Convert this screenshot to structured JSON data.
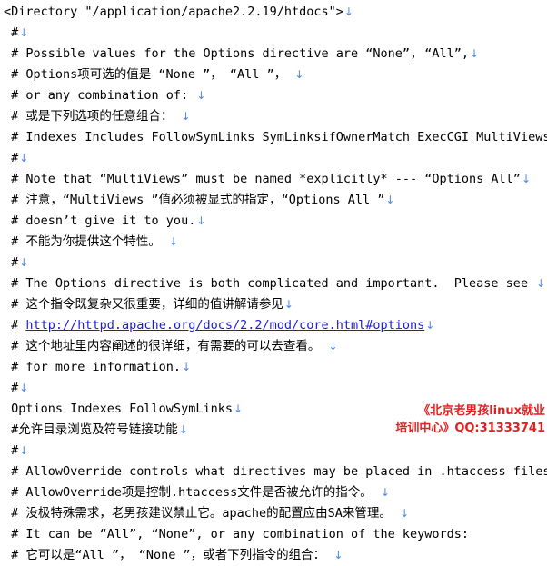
{
  "document": {
    "eol_marker": "↓",
    "lines": [
      {
        "segments": [
          {
            "type": "code",
            "text": "<Directory \"/application/apache2.2.19/htdocs\">"
          }
        ],
        "eol": true
      },
      {
        "segments": [
          {
            "type": "code",
            "text": " #"
          }
        ],
        "eol": true
      },
      {
        "segments": [
          {
            "type": "code",
            "text": " # Possible values for the Options directive are “None”, “All”,"
          }
        ],
        "eol": true
      },
      {
        "segments": [
          {
            "type": "code",
            "text": " # Options"
          },
          {
            "type": "cjk",
            "text": "项可选的值是"
          },
          {
            "type": "code",
            "text": " “None ”， “All ”， "
          }
        ],
        "eol": true
      },
      {
        "segments": [
          {
            "type": "code",
            "text": " # or any combination of: "
          }
        ],
        "eol": true
      },
      {
        "segments": [
          {
            "type": "code",
            "text": " # "
          },
          {
            "type": "cjk",
            "text": "或是下列选项的任意组合："
          },
          {
            "type": "code",
            "text": " "
          }
        ],
        "eol": true
      },
      {
        "segments": [
          {
            "type": "code",
            "text": " # Indexes Includes FollowSymLinks SymLinksifOwnerMatch ExecCGI MultiViews"
          }
        ],
        "eol": true
      },
      {
        "segments": [
          {
            "type": "code",
            "text": " #"
          }
        ],
        "eol": true
      },
      {
        "segments": [
          {
            "type": "code",
            "text": " # Note that “MultiViews” must be named *explicitly* --- “Options All”"
          }
        ],
        "eol": true
      },
      {
        "segments": [
          {
            "type": "code",
            "text": " # "
          },
          {
            "type": "cjk",
            "text": "注意，"
          },
          {
            "type": "code",
            "text": "“MultiViews ”"
          },
          {
            "type": "cjk",
            "text": "值必须被显式的指定，"
          },
          {
            "type": "code",
            "text": "“Options All ”"
          }
        ],
        "eol": true
      },
      {
        "segments": [
          {
            "type": "code",
            "text": " # doesn’t give it to you."
          }
        ],
        "eol": true
      },
      {
        "segments": [
          {
            "type": "code",
            "text": " # "
          },
          {
            "type": "cjk",
            "text": "不能为你提供这个特性。"
          },
          {
            "type": "code",
            "text": " "
          }
        ],
        "eol": true
      },
      {
        "segments": [
          {
            "type": "code",
            "text": " #"
          }
        ],
        "eol": true
      },
      {
        "segments": [
          {
            "type": "code",
            "text": " # The Options directive is both complicated and important.  Please see "
          }
        ],
        "eol": true
      },
      {
        "segments": [
          {
            "type": "code",
            "text": " # "
          },
          {
            "type": "cjk",
            "text": "这个指令既复杂又很重要，详细的值讲解请参见"
          }
        ],
        "eol": true
      },
      {
        "segments": [
          {
            "type": "code",
            "text": " # "
          },
          {
            "type": "link",
            "text": "http://httpd.apache.org/docs/2.2/mod/core.html#options"
          }
        ],
        "eol": true
      },
      {
        "segments": [
          {
            "type": "code",
            "text": " # "
          },
          {
            "type": "cjk",
            "text": "这个地址里内容阐述的很详细，有需要的可以去查看。"
          },
          {
            "type": "code",
            "text": " "
          }
        ],
        "eol": true
      },
      {
        "segments": [
          {
            "type": "code",
            "text": " # for more information."
          }
        ],
        "eol": true
      },
      {
        "segments": [
          {
            "type": "code",
            "text": " #"
          }
        ],
        "eol": true
      },
      {
        "segments": [
          {
            "type": "code",
            "text": " Options Indexes FollowSymLinks"
          }
        ],
        "eol": true
      },
      {
        "segments": [
          {
            "type": "code",
            "text": " #"
          },
          {
            "type": "cjk",
            "text": "允许目录浏览及符号链接功能"
          }
        ],
        "eol": true
      },
      {
        "segments": [
          {
            "type": "code",
            "text": " #"
          }
        ],
        "eol": true
      },
      {
        "segments": [
          {
            "type": "code",
            "text": " # AllowOverride controls what directives may be placed in .htaccess files."
          }
        ],
        "eol": false
      },
      {
        "segments": [
          {
            "type": "code",
            "text": " # AllowOverride"
          },
          {
            "type": "cjk",
            "text": "项是控制"
          },
          {
            "type": "code",
            "text": ".htaccess"
          },
          {
            "type": "cjk",
            "text": "文件是否被允许的指令。"
          },
          {
            "type": "code",
            "text": " "
          }
        ],
        "eol": true
      },
      {
        "segments": [
          {
            "type": "code",
            "text": " # "
          },
          {
            "type": "cjk",
            "text": "没极特殊需求，老男孩建议禁止它。"
          },
          {
            "type": "code",
            "text": "apache"
          },
          {
            "type": "cjk",
            "text": "的配置应由"
          },
          {
            "type": "code",
            "text": "SA"
          },
          {
            "type": "cjk",
            "text": "来管理。"
          },
          {
            "type": "code",
            "text": " "
          }
        ],
        "eol": true
      },
      {
        "segments": [
          {
            "type": "code",
            "text": " # It can be “All”, “None”, or any combination of the keywords:"
          }
        ],
        "eol": false
      },
      {
        "segments": [
          {
            "type": "code",
            "text": " # "
          },
          {
            "type": "cjk",
            "text": "它可以是"
          },
          {
            "type": "code",
            "text": "“All ”， “None ”，"
          },
          {
            "type": "cjk",
            "text": "或者下列指令的组合："
          },
          {
            "type": "code",
            "text": " "
          }
        ],
        "eol": true
      }
    ]
  },
  "watermark": {
    "line1": "《北京老男孩linux就业",
    "line2": "培训中心》QQ:31333741",
    "color": "#e32020"
  }
}
